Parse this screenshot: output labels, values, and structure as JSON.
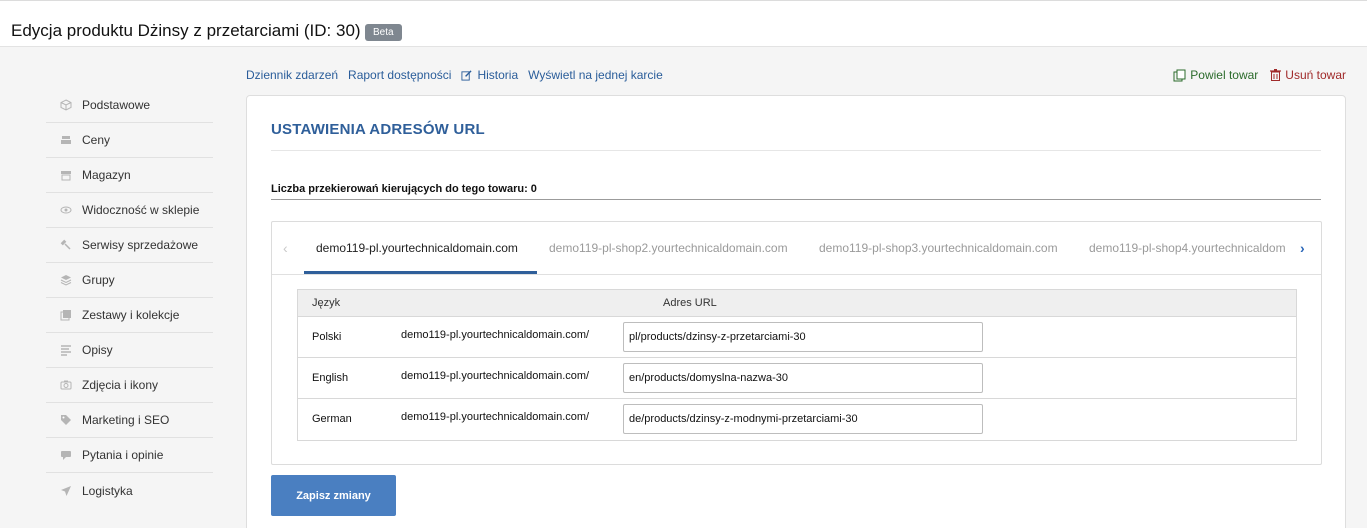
{
  "header": {
    "title": "Edycja produktu Dżinsy z przetarciami (ID: 30)",
    "badge": "Beta"
  },
  "topnav": {
    "items": [
      {
        "label": "Dziennik zdarzeń"
      },
      {
        "label": "Raport dostępności"
      },
      {
        "label": "Historia",
        "icon": "edit-icon"
      },
      {
        "label": "Wyświetl na jednej karcie"
      }
    ]
  },
  "actions": {
    "copy": {
      "label": "Powiel towar",
      "icon": "copy-icon",
      "color": "#2b6b2b"
    },
    "delete": {
      "label": "Usuń towar",
      "icon": "trash-icon",
      "color": "#a02a2a"
    }
  },
  "sidebar": {
    "items": [
      {
        "label": "Podstawowe",
        "icon": "box-icon"
      },
      {
        "label": "Ceny",
        "icon": "price-icon"
      },
      {
        "label": "Magazyn",
        "icon": "warehouse-icon"
      },
      {
        "label": "Widoczność w sklepie",
        "icon": "eye-icon"
      },
      {
        "label": "Serwisy sprzedażowe",
        "icon": "gavel-icon"
      },
      {
        "label": "Grupy",
        "icon": "layers-icon"
      },
      {
        "label": "Zestawy i kolekcje",
        "icon": "collection-icon"
      },
      {
        "label": "Opisy",
        "icon": "text-icon"
      },
      {
        "label": "Zdjęcia i ikony",
        "icon": "camera-icon"
      },
      {
        "label": "Marketing i SEO",
        "icon": "tag-icon"
      },
      {
        "label": "Pytania i opinie",
        "icon": "chat-icon"
      },
      {
        "label": "Logistyka",
        "icon": "send-icon"
      }
    ]
  },
  "main": {
    "section_title": "USTAWIENIA ADRESÓW URL",
    "redirects": "Liczba przekierowań kierujących do tego towaru: 0",
    "tabs": [
      {
        "label": "demo119-pl.yourtechnicaldomain.com",
        "active": true
      },
      {
        "label": "demo119-pl-shop2.yourtechnicaldomain.com",
        "active": false
      },
      {
        "label": "demo119-pl-shop3.yourtechnicaldomain.com",
        "active": false
      },
      {
        "label": "demo119-pl-shop4.yourtechnicaldom",
        "active": false
      }
    ],
    "table": {
      "headers": [
        "Język",
        "Adres URL"
      ],
      "rows": [
        {
          "lang": "Polski",
          "domain": "demo119-pl.yourtechnicaldomain.com/",
          "url": "pl/products/dzinsy-z-przetarciami-30"
        },
        {
          "lang": "English",
          "domain": "demo119-pl.yourtechnicaldomain.com/",
          "url": "en/products/domyslna-nazwa-30"
        },
        {
          "lang": "German",
          "domain": "demo119-pl.yourtechnicaldomain.com/",
          "url": "de/products/dzinsy-z-modnymi-przetarciami-30"
        }
      ]
    },
    "save_label": "Zapisz zmiany",
    "accent": "#2f5f9a",
    "button_color": "#4a7fc1"
  }
}
